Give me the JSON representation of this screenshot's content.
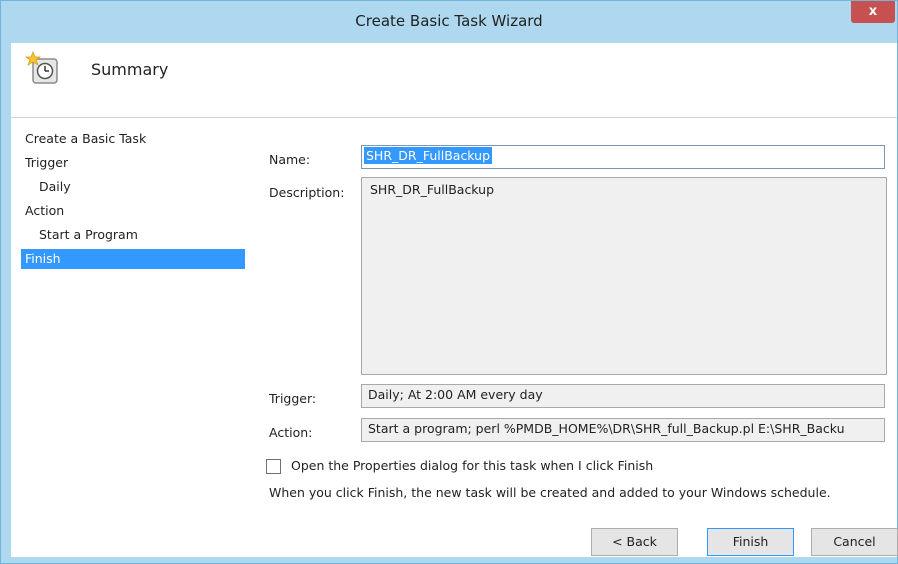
{
  "window": {
    "title": "Create Basic Task Wizard",
    "close_label": "x"
  },
  "header": {
    "title": "Summary",
    "icon": "task-scheduler-clock-icon"
  },
  "nav": {
    "items": [
      {
        "label": "Create a Basic Task"
      },
      {
        "label": "Trigger"
      },
      {
        "label": "Daily"
      },
      {
        "label": "Action"
      },
      {
        "label": "Start a Program"
      },
      {
        "label": "Finish"
      }
    ]
  },
  "summary": {
    "name_label": "Name:",
    "name_value": "SHR_DR_FullBackup",
    "description_label": "Description:",
    "description_value": "SHR_DR_FullBackup",
    "trigger_label": "Trigger:",
    "trigger_value": "Daily; At 2:00 AM every day",
    "action_label": "Action:",
    "action_value": "Start a program; perl %PMDB_HOME%\\DR\\SHR_full_Backup.pl E:\\SHR_Backu"
  },
  "options": {
    "open_properties_label": "Open the Properties dialog for this task when I click Finish",
    "open_properties_checked": false,
    "info_text": "When you click Finish, the new task will be created and added to your Windows schedule."
  },
  "buttons": {
    "back": "< Back",
    "finish": "Finish",
    "cancel": "Cancel"
  },
  "colors": {
    "title_bar": "#aed8ef",
    "close_button": "#c75050",
    "selection": "#3399ff"
  }
}
